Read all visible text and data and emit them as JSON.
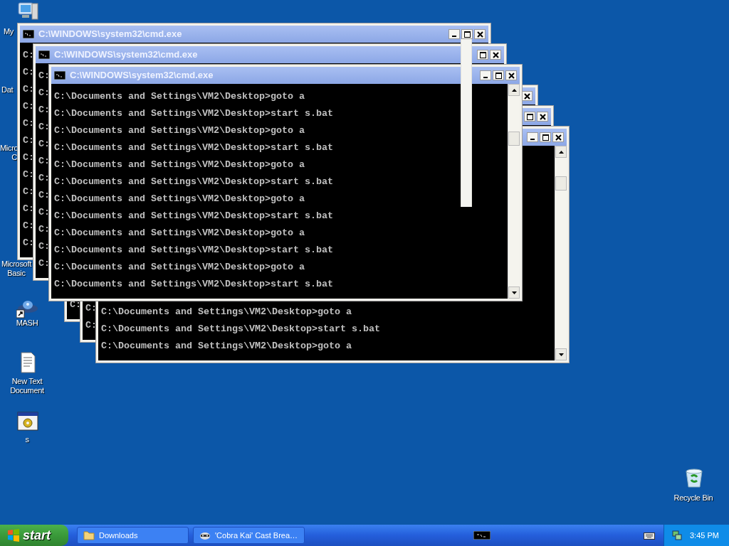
{
  "desktop_icons": [
    {
      "kind": "computer",
      "shortcut": false,
      "label_lines": [
        "My"
      ]
    },
    {
      "kind": "none",
      "shortcut": false,
      "label_lines": [
        "Dat"
      ]
    },
    {
      "kind": "none",
      "shortcut": false,
      "label_lines": [
        "Micro",
        "C"
      ]
    },
    {
      "kind": "none",
      "shortcut": false,
      "label_lines": [
        "Microsoft",
        "Basic"
      ]
    },
    {
      "kind": "satellite",
      "shortcut": true,
      "label_lines": [
        "MASH"
      ]
    },
    {
      "kind": "text-document",
      "shortcut": false,
      "label_lines": [
        "New Text",
        "Document"
      ]
    },
    {
      "kind": "batch-file",
      "shortcut": false,
      "label_lines": [
        "s"
      ]
    },
    {
      "kind": "recycle-bin",
      "shortcut": false,
      "label_lines": [
        "Recycle Bin"
      ]
    }
  ],
  "windows": [
    {
      "title": "C:\\WINDOWS\\system32\\cmd.exe",
      "minimize": true,
      "maximize": true,
      "close": true,
      "scrollbar": false,
      "lines": [
        "C:",
        "C:",
        "C:",
        "C:",
        "C:",
        "C:",
        "C:",
        "C:",
        "C:",
        "C:",
        "C:",
        "C:"
      ]
    },
    {
      "title": "C:\\WINDOWS\\system32\\cmd.exe",
      "minimize": false,
      "maximize": true,
      "close": true,
      "scrollbar": false,
      "lines": [
        "C:",
        "C:",
        "C:",
        "C:",
        "C:",
        "C:",
        "C:",
        "C:",
        "C:",
        "C:",
        "C:",
        "C:"
      ]
    },
    {
      "title": "C:\\WINDOWS\\system32\\cmd.exe",
      "minimize": true,
      "maximize": true,
      "close": true,
      "scrollbar": true,
      "lines": [
        "C:\\Documents and Settings\\VM2\\Desktop>goto a",
        "C:\\Documents and Settings\\VM2\\Desktop>start s.bat",
        "C:\\Documents and Settings\\VM2\\Desktop>goto a",
        "C:\\Documents and Settings\\VM2\\Desktop>start s.bat",
        "C:\\Documents and Settings\\VM2\\Desktop>goto a",
        "C:\\Documents and Settings\\VM2\\Desktop>start s.bat",
        "C:\\Documents and Settings\\VM2\\Desktop>goto a",
        "C:\\Documents and Settings\\VM2\\Desktop>start s.bat",
        "C:\\Documents and Settings\\VM2\\Desktop>goto a",
        "C:\\Documents and Settings\\VM2\\Desktop>start s.bat",
        "C:\\Documents and Settings\\VM2\\Desktop>goto a",
        "C:\\Documents and Settings\\VM2\\Desktop>start s.bat"
      ]
    },
    {
      "minimize": false,
      "maximize": false,
      "close": true,
      "scrollbar": false,
      "lines": [
        "C:"
      ]
    },
    {
      "minimize": false,
      "maximize": true,
      "close": true,
      "scrollbar": false,
      "lines": [
        "C:",
        "C:"
      ]
    },
    {
      "minimize": true,
      "maximize": true,
      "close": true,
      "scrollbar": true,
      "lines": [
        "C:\\Documents and Settings\\VM2\\Desktop>goto a",
        "C:\\Documents and Settings\\VM2\\Desktop>start s.bat",
        "C:\\Documents and Settings\\VM2\\Desktop>goto a"
      ]
    }
  ],
  "taskbar": {
    "start_label": "start",
    "buttons": [
      {
        "kind": "folder",
        "label": "Downloads"
      },
      {
        "kind": "video",
        "label": "'Cobra Kai' Cast Brea…"
      }
    ],
    "clock": "3:45 PM"
  }
}
